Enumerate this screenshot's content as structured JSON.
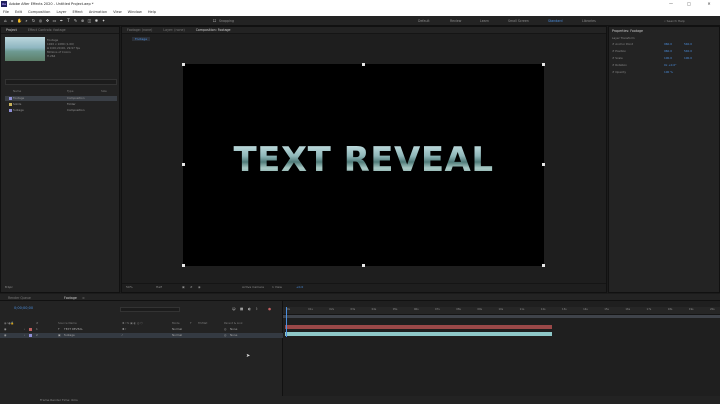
{
  "window": {
    "title": "Adobe After Effects 2020 - Untitled Project.aep *",
    "logo": "Ae"
  },
  "menu": [
    "File",
    "Edit",
    "Composition",
    "Layer",
    "Effect",
    "Animation",
    "View",
    "Window",
    "Help"
  ],
  "toolbar": {
    "snapping_label": "Snapping",
    "workspaces": [
      "Default",
      "Review",
      "Learn",
      "Small Screen",
      "Standard",
      "Libraries"
    ],
    "active_workspace": "Standard",
    "search_placeholder": "Search Help"
  },
  "project_panel": {
    "tabs": [
      "Project",
      "Effect Controls: footage"
    ],
    "info": [
      "Footage",
      "1920 x 1080 (1.00)",
      "Δ 0;00;20;00, 29.97 fps",
      "Millions of Colors",
      "H.264"
    ],
    "columns": [
      "Name",
      "Type",
      "Size"
    ],
    "rows": [
      {
        "name": "Footage",
        "type": "Composition",
        "color": "#8f8fd6",
        "selected": true
      },
      {
        "name": "Solids",
        "type": "Folder",
        "color": "#c9b35c",
        "selected": false
      },
      {
        "name": "footage",
        "type": "Composition",
        "color": "#8f8fd6",
        "selected": false
      }
    ],
    "bpc": "8 bpc"
  },
  "comp_panel": {
    "tabs": [
      "Footage: (none)",
      "Layer: (none)",
      "Composition: Footage"
    ],
    "active_tab": "Composition: Footage",
    "breadcrumb": "Footage",
    "text": "TEXT REVEAL",
    "footer": [
      "50%",
      "Half",
      "Active Camera",
      "1 View",
      "+0.0"
    ]
  },
  "properties_panel": {
    "title": "Properties: Footage",
    "section": "Layer Transform",
    "rows": [
      {
        "label": "Anchor Point",
        "values": [
          "960.0",
          "540.0"
        ]
      },
      {
        "label": "Position",
        "values": [
          "960.0",
          "540.0"
        ]
      },
      {
        "label": "Scale",
        "values": [
          "100.0",
          "100.0"
        ]
      },
      {
        "label": "Rotation",
        "values": [
          "0x +0.0°"
        ]
      },
      {
        "label": "Opacity",
        "values": [
          "100 %"
        ]
      }
    ]
  },
  "timeline": {
    "tabs": [
      "Render Queue",
      "Footage"
    ],
    "active_tab": "Footage",
    "timecode": "0;00;00;00",
    "columns": [
      "#",
      "Source Name",
      "Mode",
      "T",
      "TrkMat",
      "Parent & Link"
    ],
    "layers": [
      {
        "index": "1",
        "name": "TEXT REVEAL",
        "mode": "Normal",
        "parent": "None",
        "color": "#c06060",
        "selected": false
      },
      {
        "index": "2",
        "name": "footage",
        "mode": "Normal",
        "parent": "None",
        "color": "#8f8fd6",
        "selected": true
      }
    ],
    "ruler": [
      "0s",
      "01s",
      "02s",
      "03s",
      "04s",
      "05s",
      "06s",
      "07s",
      "08s",
      "09s",
      "10s",
      "11s",
      "12s",
      "13s",
      "14s",
      "15s",
      "16s",
      "17s",
      "18s",
      "19s",
      "20s"
    ],
    "bars": [
      {
        "color": "#9a4848",
        "end": 0.615
      },
      {
        "color": "#8ec8c8",
        "end": 0.615
      }
    ]
  },
  "statusbar": {
    "text": "Frame Render Time: 0ms"
  }
}
